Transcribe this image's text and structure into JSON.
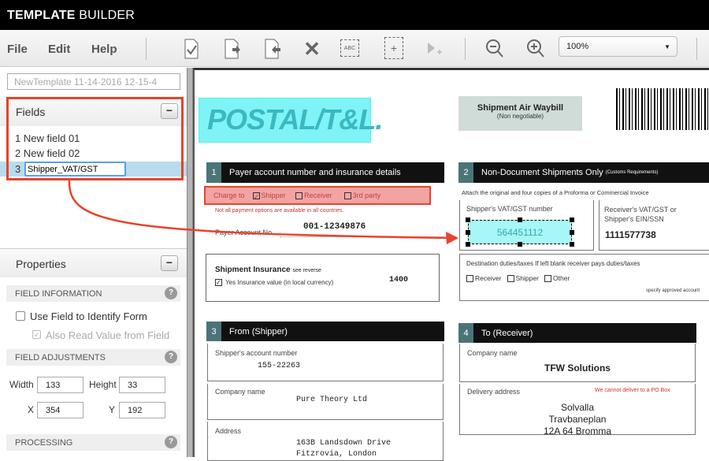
{
  "app": {
    "title_bold": "TEMPLATE",
    "title_rest": " BUILDER"
  },
  "menu": {
    "file": "File",
    "edit": "Edit",
    "help": "Help"
  },
  "toolbar": {
    "zoom_value": "100%",
    "icons": [
      "check-document-icon",
      "export-document-icon",
      "import-document-icon",
      "delete-icon",
      "text-field-icon",
      "add-region-icon",
      "add-pointer-icon",
      "zoom-out-icon",
      "zoom-in-icon"
    ],
    "abc_label": "ABC"
  },
  "left": {
    "template_name": "NewTemplate 11-14-2016 12-15-4",
    "fields": {
      "title": "Fields",
      "collapse": "−",
      "items": [
        {
          "num": "1",
          "label": "New field 01"
        },
        {
          "num": "2",
          "label": "New field 02"
        },
        {
          "num": "3",
          "label": "Shipper_VAT/GST"
        }
      ]
    },
    "properties": {
      "title": "Properties",
      "collapse": "−",
      "field_information": "FIELD INFORMATION",
      "use_field": "Use Field to Identify Form",
      "use_field_checked": false,
      "also_read": "Also Read Value from Field",
      "also_read_checked": true,
      "field_adjustments": "FIELD ADJUSTMENTS",
      "width_label": "Width",
      "width": "133",
      "height_label": "Height",
      "height": "33",
      "x_label": "X",
      "x": "354",
      "y_label": "Y",
      "y": "192",
      "processing": "PROCESSING",
      "help": "?"
    }
  },
  "colors": {
    "highlight_red": "#e8432a",
    "field_cyan": "#7ff3f5",
    "selected_row": "#b9dcec",
    "header_teal": "#4b7478"
  },
  "document": {
    "logo": "POSTAL/T&L.",
    "waybill_title": "Shipment Air Waybill",
    "waybill_sub": "(Non negotiable)",
    "s1": {
      "num": "1",
      "title": "Payer account number and insurance details",
      "charge_to": "Charge to",
      "shipper": "Shipper",
      "receiver": "Receiver",
      "third": "3rd party",
      "note": "Not all payment options are available in all countries.",
      "payer_label": "Payer Account No.",
      "payer_value": "001-12349876",
      "ins_title": "Shipment Insurance",
      "ins_see": "see reverse",
      "ins_label": "Yes Insurance value (in local currency)",
      "ins_value": "1400"
    },
    "s2": {
      "num": "2",
      "title": "Non-Document Shipments Only",
      "title_small": "(Customs Requirements)",
      "attach": "Attach the original and four copies of a Proforma or Commercial Invoice",
      "vat_label": "Shipper's VAT/GST number",
      "vat_value": "564451112",
      "recv_label": "Receiver's VAT/GST or Shipper's EIN/SSN",
      "recv_value": "1111577738",
      "dest": "Destination duties/taxes If left blank receiver pays duties/taxes",
      "receiver": "Receiver",
      "shipper": "Shipper",
      "other": "Other",
      "approved": "specify approved account"
    },
    "s3": {
      "num": "3",
      "title": "From (Shipper)",
      "acct_label": "Shipper's account number",
      "acct_value": "155-22263",
      "company_label": "Company name",
      "company_value": "Pure Theory Ltd",
      "address_label": "Address",
      "address_1": "163B Landsdown Drive",
      "address_2": "Fitzrovia, London"
    },
    "s4": {
      "num": "4",
      "title": "To (Receiver)",
      "company_label": "Company name",
      "company_value": "TFW Solutions",
      "delivery_label": "Delivery address",
      "po_note": "We cannot deliver to a PO Box",
      "addr_1": "Solvalla",
      "addr_2": "Travbaneplan",
      "addr_3": "12A 64 Bromma"
    }
  }
}
